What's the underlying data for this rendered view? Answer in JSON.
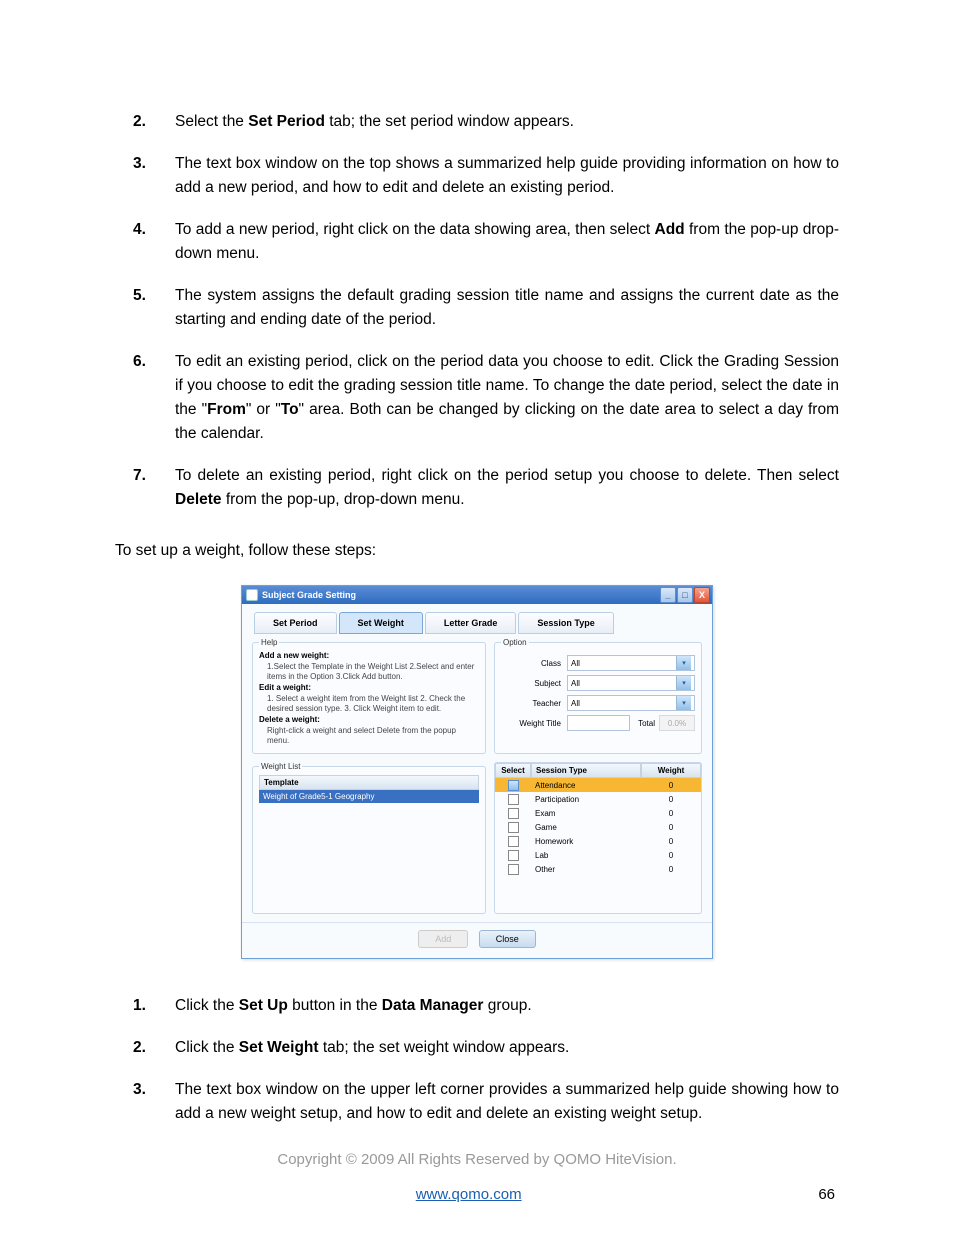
{
  "steps1": [
    {
      "n": "2.",
      "pre": "Select the ",
      "b1": "Set Period",
      "mid": " tab; the set period window appears.",
      "b2": "",
      "post": ""
    },
    {
      "n": "3.",
      "pre": "The text box window on the top shows a summarized help guide providing information on how to add a new period, and how to edit and delete an existing period.",
      "b1": "",
      "mid": "",
      "b2": "",
      "post": ""
    },
    {
      "n": "4.",
      "pre": "To add a new period, right click on the data showing area, then select ",
      "b1": "Add",
      "mid": " from the pop-up drop-down menu.",
      "b2": "",
      "post": ""
    },
    {
      "n": "5.",
      "pre": "The system assigns the default grading session title name and assigns the current date as the starting and ending date of the period.",
      "b1": "",
      "mid": "",
      "b2": "",
      "post": ""
    },
    {
      "n": "6.",
      "pre": "To edit an existing period, click on the period data you choose to edit. Click the Grading Session if you choose to edit the grading session title name. To change the date period, select the date in the \"",
      "b1": "From",
      "mid": "\" or \"",
      "b2": "To",
      "post": "\" area. Both can be changed by clicking on the date area to select a day from the calendar."
    },
    {
      "n": "7.",
      "pre": "To delete an existing period, right click on the period setup you choose to delete. Then select ",
      "b1": "Delete",
      "mid": " from the pop-up, drop-down menu.",
      "b2": "",
      "post": ""
    }
  ],
  "intro": "To set up a weight, follow these steps:",
  "dialog": {
    "title": "Subject Grade Setting",
    "tabs": [
      "Set Period",
      "Set Weight",
      "Letter Grade",
      "Session Type"
    ],
    "active_tab": 1,
    "help": {
      "legend": "Help",
      "addTitle": "Add a new weight:",
      "addBody": "1.Select the Template in the Weight List 2.Select and enter items in the Option 3.Click Add button.",
      "editTitle": "Edit a weight:",
      "editBody": "1. Select a weight item from the Weight list 2. Check the desired session type. 3. Click Weight item to edit.",
      "delTitle": "Delete a weight:",
      "delBody": "Right-click a weight and select Delete from the popup menu."
    },
    "option": {
      "legend": "Option",
      "class_label": "Class",
      "class_val": "All",
      "subject_label": "Subject",
      "subject_val": "All",
      "teacher_label": "Teacher",
      "teacher_val": "All",
      "wtitle_label": "Weight Title",
      "total_label": "Total",
      "total_val": "0.0%"
    },
    "weightList": {
      "legend": "Weight List",
      "header": "Template",
      "row": "Weight of Grade5-1 Geography"
    },
    "sessionTable": {
      "headers": [
        "Select",
        "Session Type",
        "Weight"
      ],
      "rows": [
        {
          "sel": true,
          "type": "Attendance",
          "wt": "0",
          "hl": true
        },
        {
          "sel": false,
          "type": "Participation",
          "wt": "0",
          "hl": false
        },
        {
          "sel": false,
          "type": "Exam",
          "wt": "0",
          "hl": false
        },
        {
          "sel": false,
          "type": "Game",
          "wt": "0",
          "hl": false
        },
        {
          "sel": false,
          "type": "Homework",
          "wt": "0",
          "hl": false
        },
        {
          "sel": false,
          "type": "Lab",
          "wt": "0",
          "hl": false
        },
        {
          "sel": false,
          "type": "Other",
          "wt": "0",
          "hl": false
        }
      ]
    },
    "buttons": {
      "add": "Add",
      "close": "Close"
    }
  },
  "steps2": [
    {
      "n": "1.",
      "pre": "Click the ",
      "b1": "Set Up",
      "mid": " button in the ",
      "b2": "Data Manager",
      "post": " group."
    },
    {
      "n": "2.",
      "pre": "Click the ",
      "b1": "Set Weight",
      "mid": " tab; the set weight window appears.",
      "b2": "",
      "post": ""
    },
    {
      "n": "3.",
      "pre": "The text box window on the upper left corner provides a summarized help guide showing how to add a new weight setup, and how to edit and delete an existing weight setup.",
      "b1": "",
      "mid": "",
      "b2": "",
      "post": ""
    }
  ],
  "copyright": "Copyright © 2009 All Rights Reserved by QOMO HiteVision.",
  "footer": {
    "url": "www.qomo.com",
    "page": "66"
  }
}
